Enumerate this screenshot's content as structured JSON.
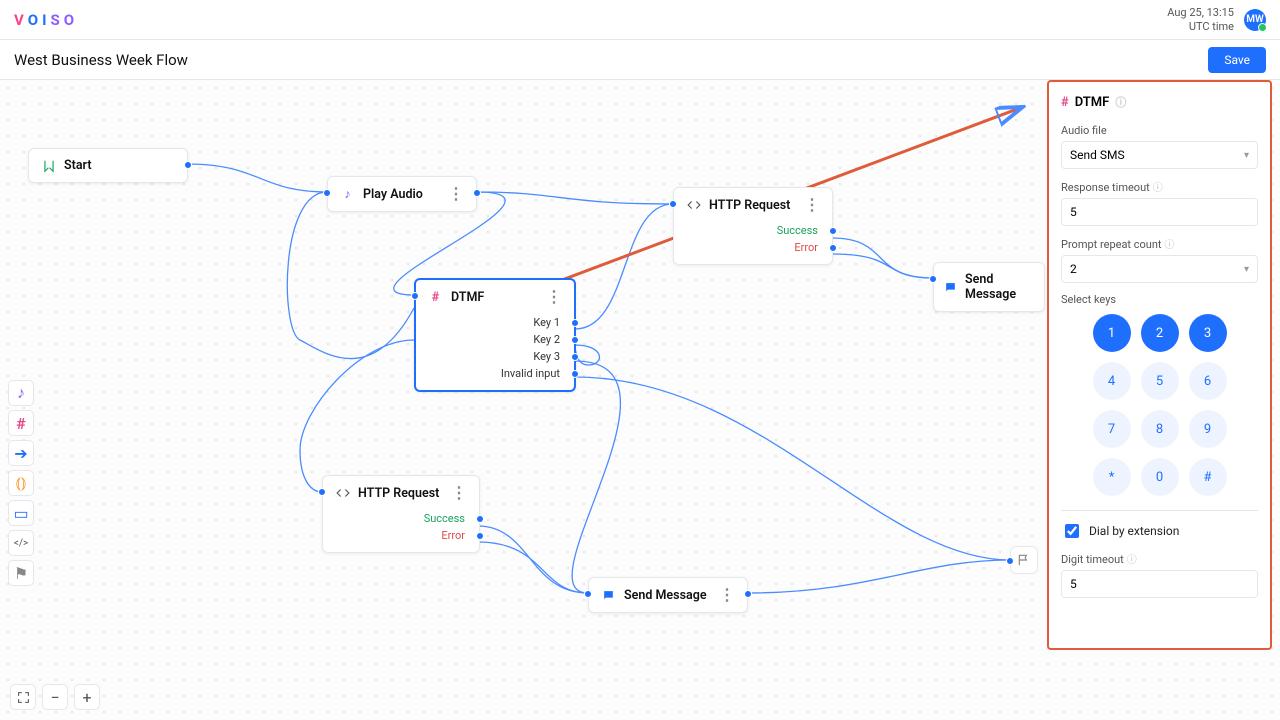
{
  "header": {
    "logo": "VOISO",
    "date": "Aug 25, 13:15",
    "tz": "UTC time",
    "avatar": "MW"
  },
  "subbar": {
    "title": "West Business Week Flow",
    "save": "Save"
  },
  "nodes": {
    "start": {
      "label": "Start"
    },
    "play_audio": {
      "label": "Play Audio"
    },
    "http1": {
      "label": "HTTP Request",
      "out_success": "Success",
      "out_error": "Error"
    },
    "dtmf": {
      "label": "DTMF",
      "out_k1": "Key 1",
      "out_k2": "Key 2",
      "out_k3": "Key 3",
      "out_inv": "Invalid input"
    },
    "http2": {
      "label": "HTTP Request",
      "out_success": "Success",
      "out_error": "Error"
    },
    "send1": {
      "label": "Send Message"
    },
    "send2": {
      "label": "Send Message"
    }
  },
  "panel": {
    "title": "DTMF",
    "audio_label": "Audio file",
    "audio_value": "Send SMS",
    "timeout_label": "Response timeout",
    "timeout_value": "5",
    "repeat_label": "Prompt repeat count",
    "repeat_value": "2",
    "keys_label": "Select keys",
    "keys": [
      {
        "k": "1",
        "on": true
      },
      {
        "k": "2",
        "on": true
      },
      {
        "k": "3",
        "on": true
      },
      {
        "k": "4",
        "on": false
      },
      {
        "k": "5",
        "on": false
      },
      {
        "k": "6",
        "on": false
      },
      {
        "k": "7",
        "on": false
      },
      {
        "k": "8",
        "on": false
      },
      {
        "k": "9",
        "on": false
      },
      {
        "k": "*",
        "on": false
      },
      {
        "k": "0",
        "on": false
      },
      {
        "k": "#",
        "on": false
      }
    ],
    "dial_ext_label": "Dial by extension",
    "dial_ext_checked": true,
    "digit_timeout_label": "Digit timeout",
    "digit_timeout_value": "5"
  },
  "toolbar_icons": [
    "music",
    "hash",
    "arrow",
    "voice",
    "message",
    "code",
    "flag"
  ]
}
